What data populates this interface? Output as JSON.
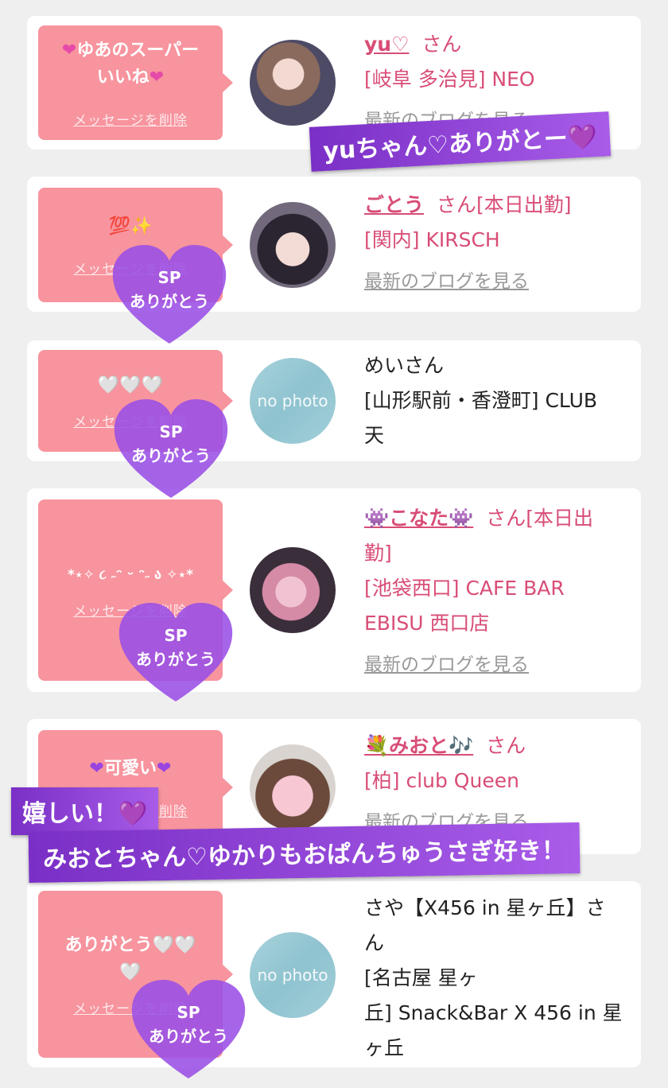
{
  "common": {
    "delete_label": "メッセージを削除",
    "san": "さん",
    "blog_label": "最新のブログを見る",
    "no_photo": "no photo"
  },
  "entries": [
    {
      "message": "ゆあのスーパー\nいいね",
      "name": "yu♡",
      "san_suffix": "",
      "shop_line1": "[岐阜 多治見] NEO",
      "has_blog": true
    },
    {
      "message": "💯✨",
      "name": "ごとう",
      "san_suffix": "[本日出勤]",
      "shop_line1": "[関内] KIRSCH",
      "has_blog": true
    },
    {
      "message": "🤍🤍🤍",
      "name": "めいさん",
      "shop_line1": "[山形駅前・香澄町] CLUB",
      "shop_line2": "天",
      "has_blog": false
    },
    {
      "message": "*⋆✧ ૮ ˶ᵔ ᵕ ᵔ˶ ა ✧⋆*",
      "name": "👾こなた👾",
      "san_suffix": "[本日出",
      "san_suffix2": "勤]",
      "shop_line1": "[池袋西口] CAFE BAR",
      "shop_line2": "EBISU 西口店",
      "has_blog": true
    },
    {
      "message": "可愛い",
      "name": "💐みおと🎶",
      "san_suffix": "",
      "shop_line1": "[柏] club Queen",
      "has_blog": true
    },
    {
      "message": "ありがとう🤍🤍\n🤍",
      "name_line1": "さや【X456 in 星ヶ丘】さ",
      "name_line2": "ん",
      "shop_line1": "[名古屋 星ヶ",
      "shop_line2": "丘] Snack&Bar X 456 in 星",
      "shop_line3": "ヶ丘",
      "has_blog": false
    }
  ],
  "stickers": {
    "sp_label": "SP\nありがとう"
  },
  "banners": {
    "yu": "yuちゃん♡ありがとー",
    "ureshii": "嬉しい！",
    "mioto": "みおとちゃん♡ゆかりもおぱんちゅうさぎ好き！"
  }
}
